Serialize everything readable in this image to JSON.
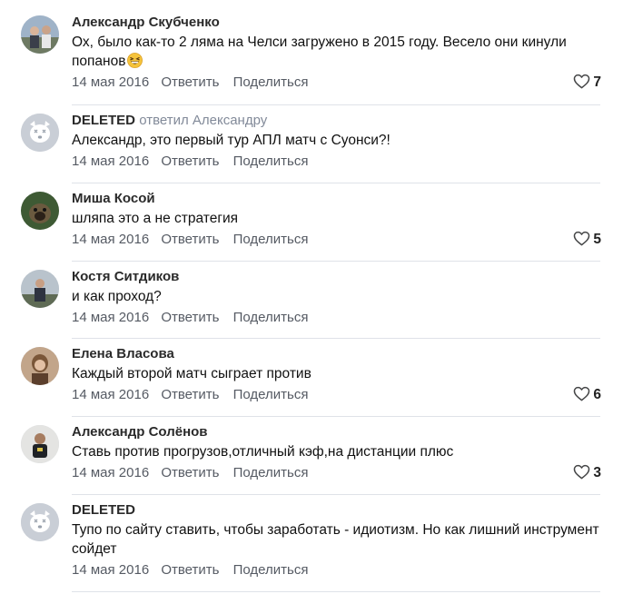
{
  "comments": [
    {
      "author": "Александр Скубченко",
      "reply_to": "",
      "text": "Ох, было как-то 2 ляма на Челси загружено в 2015 году. Весело они кинули попанов",
      "date": "14 мая 2016",
      "reply_label": "Ответить",
      "share_label": "Поделиться",
      "likes": "7",
      "avatar": "photo"
    },
    {
      "author": "DELETED",
      "reply_to": "ответил Александру",
      "text": "Александр, это первый тур АПЛ матч с Суонси?!",
      "date": "14 мая 2016",
      "reply_label": "Ответить",
      "share_label": "Поделиться",
      "likes": "",
      "avatar": "deleted"
    },
    {
      "author": "Миша Косой",
      "reply_to": "",
      "text": "шляпа это а не стратегия",
      "date": "14 мая 2016",
      "reply_label": "Ответить",
      "share_label": "Поделиться",
      "likes": "5",
      "avatar": "photo"
    },
    {
      "author": "Костя Ситдиков",
      "reply_to": "",
      "text": "и как проход?",
      "date": "14 мая 2016",
      "reply_label": "Ответить",
      "share_label": "Поделиться",
      "likes": "",
      "avatar": "photo"
    },
    {
      "author": "Елена Власова",
      "reply_to": "",
      "text": "Каждый второй матч сыграет против",
      "date": "14 мая 2016",
      "reply_label": "Ответить",
      "share_label": "Поделиться",
      "likes": "6",
      "avatar": "photo"
    },
    {
      "author": "Александр Солёнов",
      "reply_to": "",
      "text": "Ставь против прогрузов,отличный кэф,на дистанции плюс",
      "date": "14 мая 2016",
      "reply_label": "Ответить",
      "share_label": "Поделиться",
      "likes": "3",
      "avatar": "photo"
    },
    {
      "author": "DELETED",
      "reply_to": "",
      "text": "Тупо по сайту ставить, чтобы заработать - идиотизм. Но как лишний инструмент сойдет",
      "date": "14 мая 2016",
      "reply_label": "Ответить",
      "share_label": "Поделиться",
      "likes": "",
      "avatar": "deleted"
    }
  ],
  "icons": {
    "like": "heart-outline-icon",
    "emoji": "grinning-squinting-face-emoji",
    "deleted_avatar": "deleted-dog-avatar"
  },
  "colors": {
    "link": "#555a63",
    "reply_to": "#828a99",
    "divider": "#dfe2e8",
    "deleted_avatar_bg": "#c9ced6"
  }
}
